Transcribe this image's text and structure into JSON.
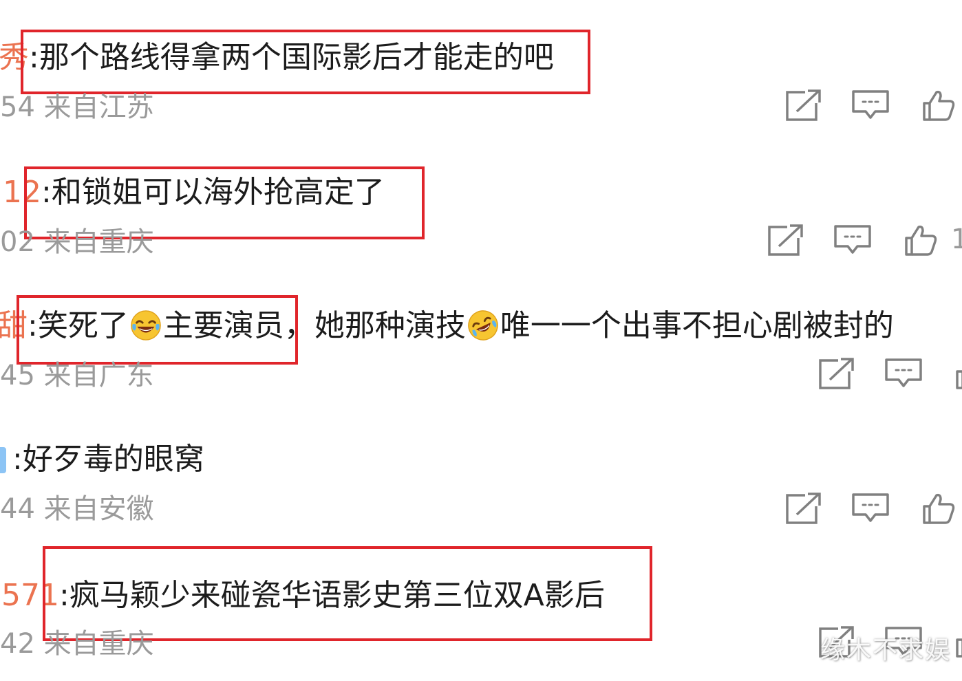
{
  "comments": [
    {
      "nick_fragment": "秀",
      "separator": ":",
      "text": "那个路线得拿两个国际影后才能走的吧",
      "time_fragment": "54",
      "location": "来自江苏"
    },
    {
      "nick_fragment": "12",
      "separator": ":",
      "text": "和锁姐可以海外抢高定了",
      "time_fragment": "02",
      "location": "来自重庆",
      "like_count_fragment": "1"
    },
    {
      "nick_fragment": "甜",
      "separator": ":",
      "text_part1": "笑死了",
      "text_part2": "主要演员",
      "text_part3": "，她那种演技",
      "text_part4": "唯一一个出事不担心剧被封的",
      "time_fragment": "45",
      "location": "来自广东"
    },
    {
      "nick_fragment": "",
      "separator": ":",
      "text": "好歹毒的眼窝",
      "time_fragment": "44",
      "location": "来自安徽"
    },
    {
      "nick_fragment": "571",
      "separator": ":",
      "text": "疯马颖少来碰瓷华语影史第三位双A影后",
      "time_fragment": "42",
      "location": "来自重庆"
    }
  ],
  "emojis": {
    "laugh_cry": "laughing-with-tears-emoji",
    "rolling_laugh": "rolling-laughing-emoji"
  },
  "icons": {
    "share": "share-icon",
    "comment": "comment-icon",
    "like": "thumbs-up-icon"
  },
  "colors": {
    "highlight": "#e0252b",
    "nickname": "#eb7350",
    "text": "#1c1c1c",
    "meta": "#9a9a9a",
    "icon": "#808080"
  },
  "watermark": "缘木不求娱"
}
